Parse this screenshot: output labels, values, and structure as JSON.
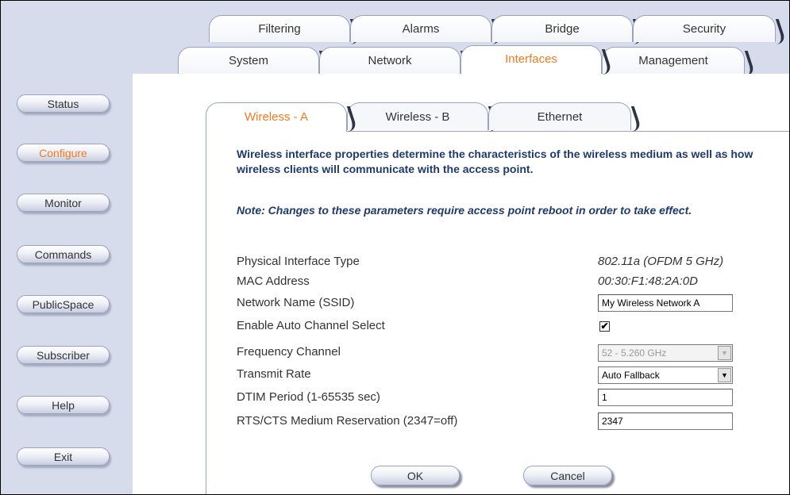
{
  "sidebar": {
    "items": [
      {
        "label": "Status"
      },
      {
        "label": "Configure"
      },
      {
        "label": "Monitor"
      },
      {
        "label": "Commands"
      },
      {
        "label": "PublicSpace"
      },
      {
        "label": "Subscriber"
      },
      {
        "label": "Help"
      },
      {
        "label": "Exit"
      }
    ],
    "active_item": "Configure"
  },
  "top_tabs": {
    "row1": [
      {
        "label": "Filtering"
      },
      {
        "label": "Alarms"
      },
      {
        "label": "Bridge"
      },
      {
        "label": "Security"
      }
    ],
    "row2": [
      {
        "label": "System"
      },
      {
        "label": "Network"
      },
      {
        "label": "Interfaces"
      },
      {
        "label": "Management"
      }
    ],
    "active_tab": "Interfaces"
  },
  "sub_tabs": {
    "items": [
      {
        "label": "Wireless - A"
      },
      {
        "label": "Wireless - B"
      },
      {
        "label": "Ethernet"
      }
    ],
    "active_tab": "Wireless - A"
  },
  "content": {
    "intro": "Wireless interface properties determine the characteristics of the wireless medium as well as how wireless clients will communicate with the access point.",
    "note": "Note: Changes to these parameters require access point reboot in order to take effect."
  },
  "form": {
    "physical_interface_type": {
      "label": "Physical Interface Type",
      "value": "802.11a (OFDM 5 GHz)"
    },
    "mac_address": {
      "label": "MAC Address",
      "value": "00:30:F1:48:2A:0D"
    },
    "network_name": {
      "label": "Network Name (SSID)",
      "value": "My Wireless Network A"
    },
    "auto_channel": {
      "label": "Enable Auto Channel Select",
      "checked": true,
      "check_glyph": "✔"
    },
    "frequency_channel": {
      "label": "Frequency Channel",
      "value": "52 - 5.260 GHz",
      "disabled": true
    },
    "transmit_rate": {
      "label": "Transmit Rate",
      "value": "Auto Fallback"
    },
    "dtim_period": {
      "label": "DTIM Period (1-65535 sec)",
      "value": "1"
    },
    "rts_cts": {
      "label": "RTS/CTS Medium Reservation (2347=off)",
      "value": "2347"
    }
  },
  "buttons": {
    "ok_label": "OK",
    "cancel_label": "Cancel"
  },
  "colors": {
    "accent": "#f07a21",
    "nav_background": "#d7dced",
    "heading_text": "#1f3a6b"
  }
}
